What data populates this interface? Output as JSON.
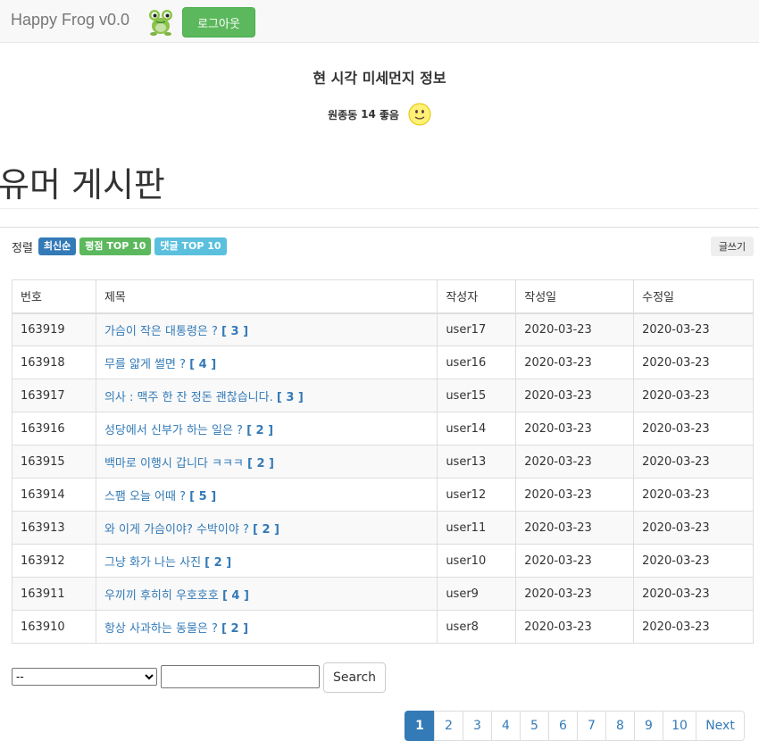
{
  "navbar": {
    "brand": "Happy Frog v0.0",
    "logout_label": "로그아웃"
  },
  "dust": {
    "title": "현 시각 미세먼지 정보",
    "location": "원종동",
    "value": "14",
    "status": "좋음"
  },
  "board": {
    "title": "유머 게시판",
    "sort_label": "정렬",
    "sort_options": [
      "최신순",
      "평점 TOP 10",
      "댓글 TOP 10"
    ],
    "write_label": "글쓰기",
    "columns": [
      "번호",
      "제목",
      "작성자",
      "작성일",
      "수정일"
    ],
    "rows": [
      {
        "no": "163919",
        "title": "가슴이 작은 대통령은 ?",
        "comments": "[ 3 ]",
        "author": "user17",
        "created": "2020-03-23",
        "updated": "2020-03-23"
      },
      {
        "no": "163918",
        "title": "무를 얇게 썰면 ?",
        "comments": "[ 4 ]",
        "author": "user16",
        "created": "2020-03-23",
        "updated": "2020-03-23"
      },
      {
        "no": "163917",
        "title": "의사 : 맥주 한 잔 정돈 괜찮습니다.",
        "comments": "[ 3 ]",
        "author": "user15",
        "created": "2020-03-23",
        "updated": "2020-03-23"
      },
      {
        "no": "163916",
        "title": "성당에서 신부가 하는 일은 ?",
        "comments": "[ 2 ]",
        "author": "user14",
        "created": "2020-03-23",
        "updated": "2020-03-23"
      },
      {
        "no": "163915",
        "title": "백마로 이행시 갑니다 ㅋㅋㅋ",
        "comments": "[ 2 ]",
        "author": "user13",
        "created": "2020-03-23",
        "updated": "2020-03-23"
      },
      {
        "no": "163914",
        "title": "스팸 오늘 어때 ?",
        "comments": "[ 5 ]",
        "author": "user12",
        "created": "2020-03-23",
        "updated": "2020-03-23"
      },
      {
        "no": "163913",
        "title": "와 이게 가슴이야? 수박이야 ?",
        "comments": "[ 2 ]",
        "author": "user11",
        "created": "2020-03-23",
        "updated": "2020-03-23"
      },
      {
        "no": "163912",
        "title": "그냥 화가 나는 사진",
        "comments": "[ 2 ]",
        "author": "user10",
        "created": "2020-03-23",
        "updated": "2020-03-23"
      },
      {
        "no": "163911",
        "title": "우끼끼 후히히 우호호호",
        "comments": "[ 4 ]",
        "author": "user9",
        "created": "2020-03-23",
        "updated": "2020-03-23"
      },
      {
        "no": "163910",
        "title": "항상 사과하는 동물은 ?",
        "comments": "[ 2 ]",
        "author": "user8",
        "created": "2020-03-23",
        "updated": "2020-03-23"
      }
    ]
  },
  "search": {
    "select_value": "--",
    "input_value": "",
    "button_label": "Search"
  },
  "pagination": {
    "pages": [
      "1",
      "2",
      "3",
      "4",
      "5",
      "6",
      "7",
      "8",
      "9",
      "10"
    ],
    "active": "1",
    "next_label": "Next"
  },
  "colors": {
    "primary": "#337ab7",
    "success": "#5cb85c",
    "info": "#5bc0de"
  },
  "icons": {
    "frog": "frog-logo-icon",
    "dust_status": "smiley-face-icon"
  }
}
